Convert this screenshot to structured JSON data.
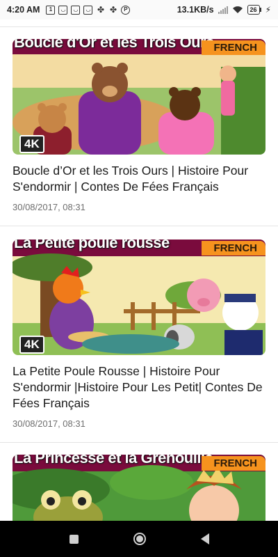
{
  "status_bar": {
    "time": "4:20 AM",
    "calendar_icon_text": "1",
    "app_letter": "P",
    "net_speed": "13.1KB/s",
    "battery_level": "26"
  },
  "videos": [
    {
      "thumb_title": "Boucle d'Or et les Trois Ours",
      "language_badge": "FRENCH",
      "quality_badge": "4K",
      "title": "Boucle d’Or et les Trois Ours | Histoire Pour S'endormir | Contes De Fées Français",
      "date": "30/08/2017, 08:31"
    },
    {
      "thumb_title": "La Petite poule rousse",
      "language_badge": "FRENCH",
      "quality_badge": "4K",
      "title": "La Petite Poule Rousse | Histoire Pour S'endormir |Histoire Pour Les Petit| Contes De Fées Français",
      "date": "30/08/2017, 08:31"
    },
    {
      "thumb_title": "La Princesse et la Grenouille",
      "language_badge": "FRENCH"
    }
  ]
}
